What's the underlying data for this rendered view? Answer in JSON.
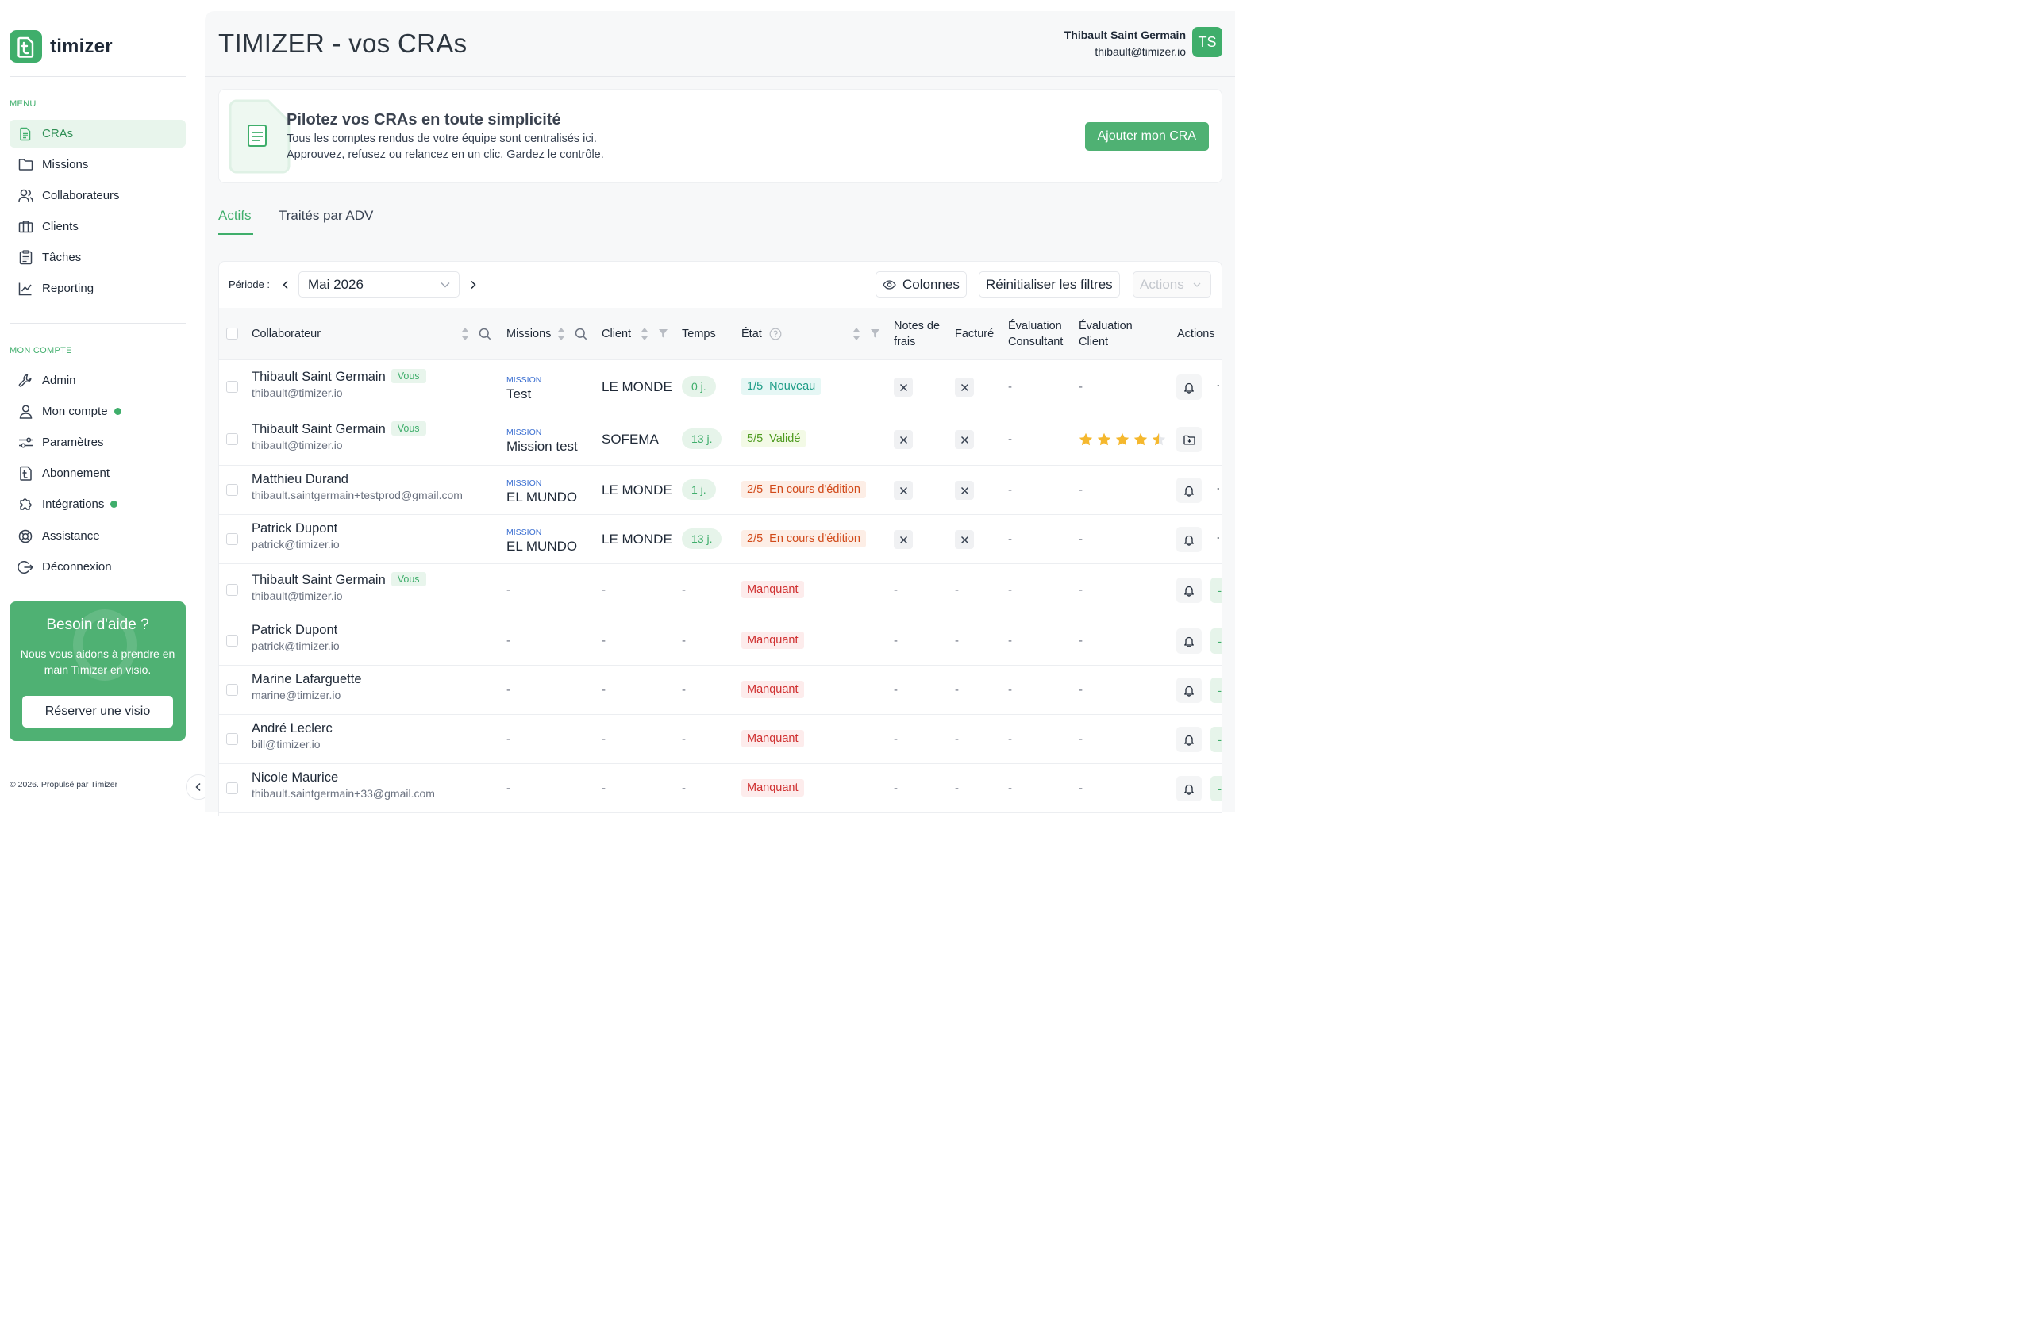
{
  "app": {
    "name": "timizer"
  },
  "sidebar": {
    "menu_title": "MENU",
    "menu_items": [
      {
        "label": "CRAs",
        "icon": "document-icon"
      },
      {
        "label": "Missions",
        "icon": "folder-icon"
      },
      {
        "label": "Collaborateurs",
        "icon": "users-icon"
      },
      {
        "label": "Clients",
        "icon": "briefcase-icon"
      },
      {
        "label": "Tâches",
        "icon": "clipboard-icon"
      },
      {
        "label": "Reporting",
        "icon": "chart-icon"
      }
    ],
    "account_title": "MON COMPTE",
    "account_items": [
      {
        "label": "Admin",
        "icon": "wrench-icon"
      },
      {
        "label": "Mon compte",
        "icon": "user-icon"
      },
      {
        "label": "Paramètres",
        "icon": "settings-icon"
      },
      {
        "label": "Abonnement",
        "icon": "subscription-icon"
      },
      {
        "label": "Intégrations",
        "icon": "puzzle-icon"
      },
      {
        "label": "Assistance",
        "icon": "lifebuoy-icon"
      },
      {
        "label": "Déconnexion",
        "icon": "logout-icon"
      }
    ],
    "help": {
      "title": "Besoin d'aide ?",
      "text": "Nous vous aidons à prendre en main Timizer en visio.",
      "button": "Réserver une visio"
    },
    "footer": "© 2026. Propulsé par Timizer"
  },
  "header": {
    "title": "TIMIZER - vos CRAs",
    "user_name": "Thibault Saint Germain",
    "user_email": "thibault@timizer.io",
    "avatar_initials": "TS"
  },
  "banner": {
    "title": "Pilotez vos CRAs en toute simplicité",
    "line1": "Tous les comptes rendus de votre équipe sont centralisés ici.",
    "line2": "Approuvez, refusez ou relancez en un clic. Gardez le contrôle.",
    "button": "Ajouter mon CRA"
  },
  "tabs": [
    {
      "label": "Actifs"
    },
    {
      "label": "Traités par ADV"
    }
  ],
  "toolbar": {
    "period_label": "Période :",
    "period_value": "Mai 2026",
    "columns_label": "Colonnes",
    "reset_label": "Réinitialiser les filtres",
    "actions_label": "Actions"
  },
  "table": {
    "headers": {
      "collaborateur": "Collaborateur",
      "missions": "Missions",
      "client": "Client",
      "temps": "Temps",
      "etat": "État",
      "notes_1": "Notes de",
      "notes_2": "frais",
      "facture": "Facturé",
      "eval_consultant_1": "Évaluation",
      "eval_consultant_2": "Consultant",
      "eval_client_1": "Évaluation",
      "eval_client_2": "Client",
      "actions": "Actions"
    },
    "vous_label": "Vous",
    "mission_tag": "MISSION",
    "dash": "-",
    "rows": [
      {
        "name": "Thibault Saint Germain",
        "email": "thibault@timizer.io",
        "vous": true,
        "mission": "Test",
        "client": "LE MONDE",
        "temps": "0 j.",
        "state_count": "1/5",
        "state_label": "Nouveau",
        "state_type": "nouveau",
        "notes": "x",
        "facture": "x",
        "eval_consultant": "-",
        "eval_client": "-",
        "action": "bell"
      },
      {
        "name": "Thibault Saint Germain",
        "email": "thibault@timizer.io",
        "vous": true,
        "mission": "Mission test",
        "client": "SOFEMA",
        "temps": "13 j.",
        "state_count": "5/5",
        "state_label": "Validé",
        "state_type": "valide",
        "notes": "x",
        "facture": "x",
        "eval_consultant": "-",
        "eval_client_stars": 4.5,
        "action": "folder"
      },
      {
        "name": "Matthieu Durand",
        "email": "thibault.saintgermain+testprod@gmail.com",
        "vous": false,
        "mission": "EL MUNDO",
        "client": "LE MONDE",
        "temps": "1 j.",
        "state_count": "2/5",
        "state_label": "En cours d'édition",
        "state_type": "edit",
        "notes": "x",
        "facture": "x",
        "eval_consultant": "-",
        "eval_client": "-",
        "action": "bell"
      },
      {
        "name": "Patrick Dupont",
        "email": "patrick@timizer.io",
        "vous": false,
        "mission": "EL MUNDO",
        "client": "LE MONDE",
        "temps": "13 j.",
        "state_count": "2/5",
        "state_label": "En cours d'édition",
        "state_type": "edit",
        "notes": "x",
        "facture": "x",
        "eval_consultant": "-",
        "eval_client": "-",
        "action": "bell"
      },
      {
        "name": "Thibault Saint Germain",
        "email": "thibault@timizer.io",
        "vous": true,
        "state_label": "Manquant",
        "state_type": "manquant",
        "action": "bell"
      },
      {
        "name": "Patrick Dupont",
        "email": "patrick@timizer.io",
        "vous": false,
        "state_label": "Manquant",
        "state_type": "manquant",
        "action": "bell"
      },
      {
        "name": "Marine Lafarguette",
        "email": "marine@timizer.io",
        "vous": false,
        "state_label": "Manquant",
        "state_type": "manquant",
        "action": "bell"
      },
      {
        "name": "André Leclerc",
        "email": "bill@timizer.io",
        "vous": false,
        "state_label": "Manquant",
        "state_type": "manquant",
        "action": "bell"
      },
      {
        "name": "Nicole Maurice",
        "email": "thibault.saintgermain+33@gmail.com",
        "vous": false,
        "state_label": "Manquant",
        "state_type": "manquant",
        "action": "bell"
      }
    ]
  },
  "colors": {
    "accent": "#3fae6b",
    "banner_green": "#4fb173"
  }
}
